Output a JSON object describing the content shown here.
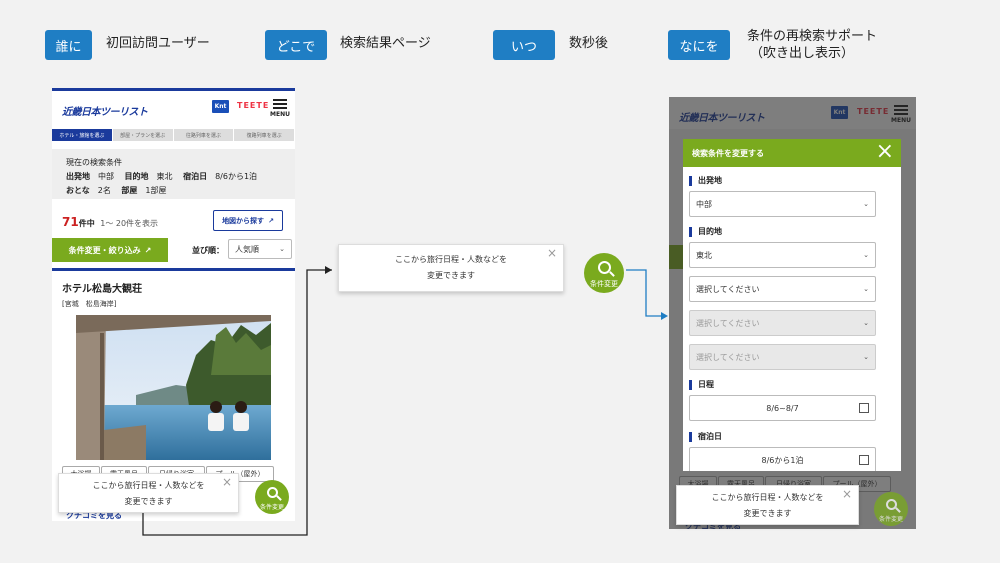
{
  "tags": [
    {
      "label": "誰に",
      "text": "初回訪問ユーザー"
    },
    {
      "label": "どこで",
      "text": "検索結果ページ"
    },
    {
      "label": "いつ",
      "text": "数秒後"
    },
    {
      "label": "なにを",
      "text": "条件の再検索サポート",
      "text2": "（吹き出し表示）"
    }
  ],
  "header": {
    "logo": "近畿日本ツーリスト",
    "knt": "Knt",
    "badge": "TEETE",
    "menu": "MENU"
  },
  "steps": [
    "ホテル・旅館を選ぶ",
    "部屋・プランを選ぶ",
    "往路列車を選ぶ",
    "復路列車を選ぶ"
  ],
  "conditions": {
    "title": "現在の検索条件",
    "row1": [
      [
        "出発地",
        "中部"
      ],
      [
        "目的地",
        "東北"
      ],
      [
        "宿泊日",
        "8/6から1泊"
      ]
    ],
    "row2": [
      [
        "おとな",
        "2名"
      ],
      [
        "部屋",
        "1部屋"
      ]
    ]
  },
  "results": {
    "count": "71",
    "count_suffix": "件中",
    "range": "1～ 20件を表示",
    "map_button": "地図から探す"
  },
  "change_button": "条件変更・絞り込み",
  "sort": {
    "label": "並び順：",
    "value": "人気順"
  },
  "hotel": {
    "name": "ホテル松島大観荘",
    "area": "[宮城　松島海岸]"
  },
  "chips": [
    "大浴場",
    "露天風呂",
    "日帰り浴室",
    "プール（屋外）"
  ],
  "review_link": "クチコミを見る",
  "bubble": {
    "line1": "ここから旅行日程・人数などを",
    "line2": "変更できます",
    "close": "×"
  },
  "fab_label": "条件変更",
  "modal": {
    "title": "検索条件を変更する",
    "close": "×",
    "departure_label": "出発地",
    "departure_value": "中部",
    "destination_label": "目的地",
    "destination_value": "東北",
    "select_placeholder": "選択してください",
    "schedule_label": "日程",
    "schedule_value": "8/6~8/7",
    "nights_label": "宿泊日",
    "nights_value": "8/6から1泊"
  },
  "colors": {
    "tag_blue": "#1f7ec4",
    "brand_navy": "#1a3a9c",
    "green": "#7aaa1e",
    "arrow_blue": "#1f7ec4"
  }
}
